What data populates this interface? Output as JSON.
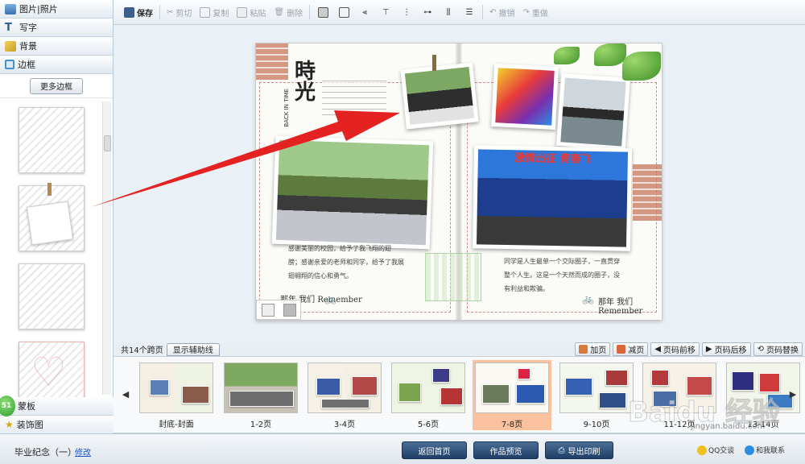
{
  "sidebar": {
    "tabs": [
      {
        "label": "图片|照片",
        "icon": "person-icon",
        "color": "#3a6fb0"
      },
      {
        "label": "写字",
        "icon": "text-t-icon",
        "color": "#2a5f9a"
      },
      {
        "label": "背景",
        "icon": "background-icon",
        "color": "#c8a020"
      },
      {
        "label": "边框",
        "icon": "frame-icon",
        "color": "#4a90d0"
      }
    ],
    "more_button": "更多边框",
    "bottom_tabs": [
      {
        "label": "蒙板",
        "icon": "mask-icon"
      },
      {
        "label": "装饰图",
        "icon": "star-icon"
      }
    ],
    "badge": "51"
  },
  "toolbar": {
    "save": "保存",
    "cut": "剪切",
    "copy": "复制",
    "paste": "粘贴",
    "delete": "删除",
    "undo": "撤销",
    "redo": "重做"
  },
  "album": {
    "title": "時光",
    "subtitle": "BACK IN TIME",
    "left_text_lines": [
      "感谢美丽的校园，给予了我飞翔的翅",
      "膀；感谢亲爱的老师和同学，给予了我展",
      "翅翱翔的信心和勇气。"
    ],
    "right_text_lines": [
      "同学是人生最单一个交际圈子，一直贯穿",
      "整个人生。这是一个天然而成的圈子，没",
      "有利益和欺骗。"
    ],
    "stage_banner": "激情出征 青春飞",
    "remember_left": "那年 我们 Remember",
    "remember_right": "那年 我们 Remember"
  },
  "pagebar": {
    "page_count": "共14个跨页",
    "guide_button": "显示辅助线",
    "add_page": "加页",
    "remove_page": "减页",
    "move_front": "页码前移",
    "move_back": "页码后移",
    "swap_page": "页码替换"
  },
  "thumbnails": [
    {
      "label": "封底-封面",
      "selected": false
    },
    {
      "label": "1-2页",
      "selected": false
    },
    {
      "label": "3-4页",
      "selected": false
    },
    {
      "label": "5-6页",
      "selected": false
    },
    {
      "label": "7-8页",
      "selected": true
    },
    {
      "label": "9-10页",
      "selected": false
    },
    {
      "label": "11-12页",
      "selected": false
    },
    {
      "label": "13-14页",
      "selected": false
    }
  ],
  "status": {
    "album_name": "毕业纪念（一）",
    "modify": "修改",
    "back_home": "返回首页",
    "preview": "作品预览",
    "export_print": "导出印刷",
    "qq": "QQ交谈",
    "contact": "和我联系"
  },
  "watermark": {
    "text": "Baidu 经验",
    "url": "jingyan.baidu.com"
  },
  "colors": {
    "selected_thumb": "#f9c19d",
    "accent_button": "#1f3e66",
    "arrow": "#e52222"
  }
}
